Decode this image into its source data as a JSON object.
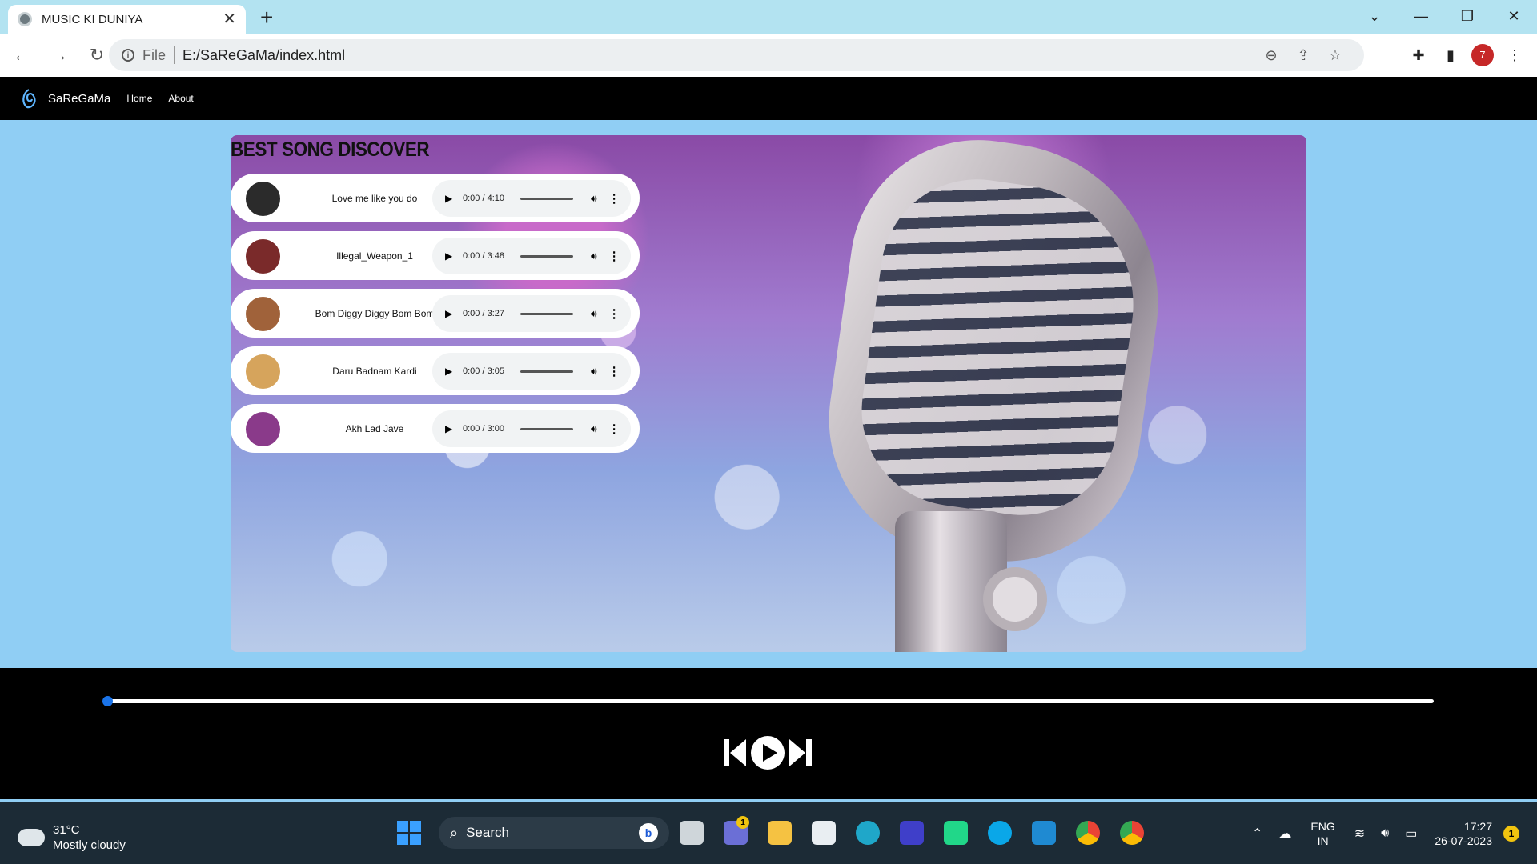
{
  "browser": {
    "tab_title": "MUSIC KI DUNIYA",
    "tab_close": "✕",
    "new_tab": "+",
    "window_controls": [
      "⌄",
      "—",
      "❐",
      "✕"
    ],
    "url_scheme": "File",
    "url": "E:/SaReGaMa/index.html",
    "omnibox_icons": [
      "zoom-icon",
      "share-icon",
      "star-icon"
    ],
    "profile_badge": "7"
  },
  "site": {
    "brand": "SaReGaMa",
    "nav": [
      {
        "label": "Home"
      },
      {
        "label": "About"
      }
    ],
    "section_title": "BEST SONG DISCOVER",
    "songs": [
      {
        "name": "Love me like you do",
        "time": "0:00 / 4:10",
        "color": "#2b2b2b"
      },
      {
        "name": "Illegal_Weapon_1",
        "time": "0:00 / 3:48",
        "color": "#7a2a2a"
      },
      {
        "name": "Bom Diggy Diggy Bom Bom",
        "time": "0:00 / 3:27",
        "color": "#a0623a"
      },
      {
        "name": "Daru Badnam Kardi",
        "time": "0:00 / 3:05",
        "color": "#d6a45c"
      },
      {
        "name": "Akh Lad Jave",
        "time": "0:00 / 3:00",
        "color": "#8a3a8a"
      }
    ],
    "player": {
      "progress": 0,
      "accent": "#1a73e8"
    }
  },
  "taskbar": {
    "temperature": "31°C",
    "weather": "Mostly cloudy",
    "search_placeholder": "Search",
    "teams_badge": "1",
    "lang_top": "ENG",
    "lang_bottom": "IN",
    "time": "17:27",
    "date": "26-07-2023",
    "notifications": "1"
  }
}
